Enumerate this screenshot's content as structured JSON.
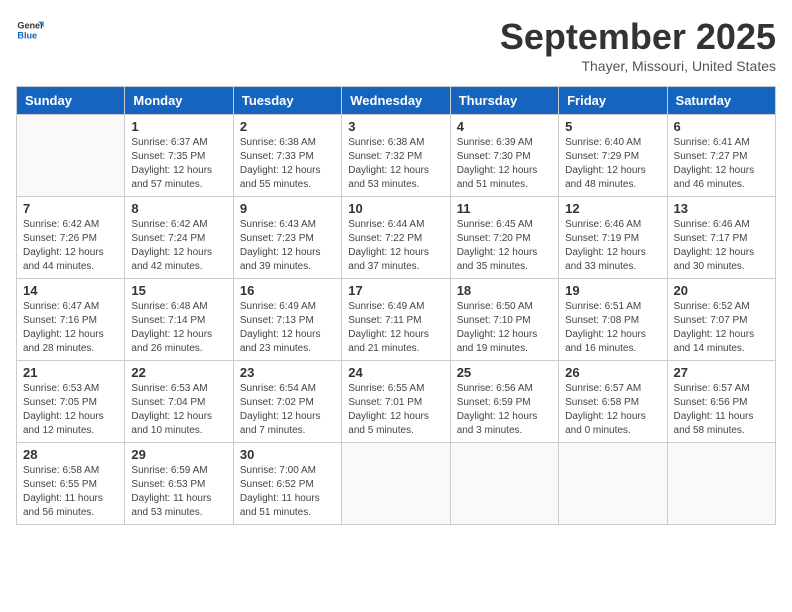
{
  "logo": {
    "line1": "General",
    "line2": "Blue"
  },
  "title": "September 2025",
  "subtitle": "Thayer, Missouri, United States",
  "days_of_week": [
    "Sunday",
    "Monday",
    "Tuesday",
    "Wednesday",
    "Thursday",
    "Friday",
    "Saturday"
  ],
  "weeks": [
    [
      {
        "day": "",
        "info": ""
      },
      {
        "day": "1",
        "info": "Sunrise: 6:37 AM\nSunset: 7:35 PM\nDaylight: 12 hours\nand 57 minutes."
      },
      {
        "day": "2",
        "info": "Sunrise: 6:38 AM\nSunset: 7:33 PM\nDaylight: 12 hours\nand 55 minutes."
      },
      {
        "day": "3",
        "info": "Sunrise: 6:38 AM\nSunset: 7:32 PM\nDaylight: 12 hours\nand 53 minutes."
      },
      {
        "day": "4",
        "info": "Sunrise: 6:39 AM\nSunset: 7:30 PM\nDaylight: 12 hours\nand 51 minutes."
      },
      {
        "day": "5",
        "info": "Sunrise: 6:40 AM\nSunset: 7:29 PM\nDaylight: 12 hours\nand 48 minutes."
      },
      {
        "day": "6",
        "info": "Sunrise: 6:41 AM\nSunset: 7:27 PM\nDaylight: 12 hours\nand 46 minutes."
      }
    ],
    [
      {
        "day": "7",
        "info": "Sunrise: 6:42 AM\nSunset: 7:26 PM\nDaylight: 12 hours\nand 44 minutes."
      },
      {
        "day": "8",
        "info": "Sunrise: 6:42 AM\nSunset: 7:24 PM\nDaylight: 12 hours\nand 42 minutes."
      },
      {
        "day": "9",
        "info": "Sunrise: 6:43 AM\nSunset: 7:23 PM\nDaylight: 12 hours\nand 39 minutes."
      },
      {
        "day": "10",
        "info": "Sunrise: 6:44 AM\nSunset: 7:22 PM\nDaylight: 12 hours\nand 37 minutes."
      },
      {
        "day": "11",
        "info": "Sunrise: 6:45 AM\nSunset: 7:20 PM\nDaylight: 12 hours\nand 35 minutes."
      },
      {
        "day": "12",
        "info": "Sunrise: 6:46 AM\nSunset: 7:19 PM\nDaylight: 12 hours\nand 33 minutes."
      },
      {
        "day": "13",
        "info": "Sunrise: 6:46 AM\nSunset: 7:17 PM\nDaylight: 12 hours\nand 30 minutes."
      }
    ],
    [
      {
        "day": "14",
        "info": "Sunrise: 6:47 AM\nSunset: 7:16 PM\nDaylight: 12 hours\nand 28 minutes."
      },
      {
        "day": "15",
        "info": "Sunrise: 6:48 AM\nSunset: 7:14 PM\nDaylight: 12 hours\nand 26 minutes."
      },
      {
        "day": "16",
        "info": "Sunrise: 6:49 AM\nSunset: 7:13 PM\nDaylight: 12 hours\nand 23 minutes."
      },
      {
        "day": "17",
        "info": "Sunrise: 6:49 AM\nSunset: 7:11 PM\nDaylight: 12 hours\nand 21 minutes."
      },
      {
        "day": "18",
        "info": "Sunrise: 6:50 AM\nSunset: 7:10 PM\nDaylight: 12 hours\nand 19 minutes."
      },
      {
        "day": "19",
        "info": "Sunrise: 6:51 AM\nSunset: 7:08 PM\nDaylight: 12 hours\nand 16 minutes."
      },
      {
        "day": "20",
        "info": "Sunrise: 6:52 AM\nSunset: 7:07 PM\nDaylight: 12 hours\nand 14 minutes."
      }
    ],
    [
      {
        "day": "21",
        "info": "Sunrise: 6:53 AM\nSunset: 7:05 PM\nDaylight: 12 hours\nand 12 minutes."
      },
      {
        "day": "22",
        "info": "Sunrise: 6:53 AM\nSunset: 7:04 PM\nDaylight: 12 hours\nand 10 minutes."
      },
      {
        "day": "23",
        "info": "Sunrise: 6:54 AM\nSunset: 7:02 PM\nDaylight: 12 hours\nand 7 minutes."
      },
      {
        "day": "24",
        "info": "Sunrise: 6:55 AM\nSunset: 7:01 PM\nDaylight: 12 hours\nand 5 minutes."
      },
      {
        "day": "25",
        "info": "Sunrise: 6:56 AM\nSunset: 6:59 PM\nDaylight: 12 hours\nand 3 minutes."
      },
      {
        "day": "26",
        "info": "Sunrise: 6:57 AM\nSunset: 6:58 PM\nDaylight: 12 hours\nand 0 minutes."
      },
      {
        "day": "27",
        "info": "Sunrise: 6:57 AM\nSunset: 6:56 PM\nDaylight: 11 hours\nand 58 minutes."
      }
    ],
    [
      {
        "day": "28",
        "info": "Sunrise: 6:58 AM\nSunset: 6:55 PM\nDaylight: 11 hours\nand 56 minutes."
      },
      {
        "day": "29",
        "info": "Sunrise: 6:59 AM\nSunset: 6:53 PM\nDaylight: 11 hours\nand 53 minutes."
      },
      {
        "day": "30",
        "info": "Sunrise: 7:00 AM\nSunset: 6:52 PM\nDaylight: 11 hours\nand 51 minutes."
      },
      {
        "day": "",
        "info": ""
      },
      {
        "day": "",
        "info": ""
      },
      {
        "day": "",
        "info": ""
      },
      {
        "day": "",
        "info": ""
      }
    ]
  ]
}
